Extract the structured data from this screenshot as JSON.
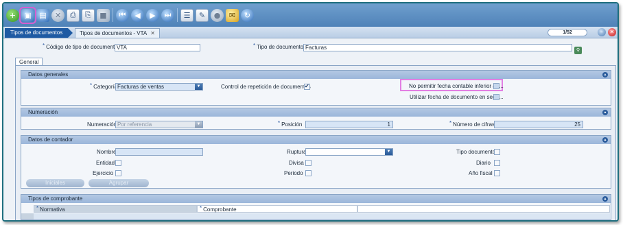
{
  "toolbar": {
    "buttons": [
      "add-icon",
      "save-icon",
      "save-close-icon",
      "delete-icon",
      "print-icon",
      "print-preview-icon",
      "disabled-icon",
      "first-icon",
      "previous-icon",
      "next-icon",
      "last-icon",
      "document-icon",
      "attach-icon",
      "disabled-icon-2",
      "email-icon",
      "refresh-icon"
    ]
  },
  "tabs": {
    "parent": "Tipos de documentos",
    "current": "Tipos de documentos - VTA",
    "close": "✕",
    "pager": "1/52"
  },
  "header": {
    "code_label": "Código de tipo de documento",
    "code_value": "VTA",
    "type_label": "Tipo de documento",
    "type_value": "Facturas"
  },
  "general_tab": "General",
  "datos_generales": {
    "title": "Datos generales",
    "categoria_label": "Categoría",
    "categoria_value": "Facturas de ventas",
    "control_label": "Control de repetición de documentos",
    "no_permitir_label": "No permitir fecha contable inferior a f...",
    "utilizar_label": "Utilizar fecha de documento en segu..."
  },
  "numeracion": {
    "title": "Numeración",
    "numeracion_label": "Numeración",
    "numeracion_value": "Por referencia",
    "posicion_label": "Posición",
    "posicion_value": "1",
    "cifras_label": "Número de cifras",
    "cifras_value": "25"
  },
  "contador": {
    "title": "Datos de contador",
    "nombre_label": "Nombre",
    "ruptura_label": "Ruptura",
    "tipo_doc_label": "Tipo documento",
    "entidad_label": "Entidad",
    "divisa_label": "Divisa",
    "diario_label": "Diario",
    "ejercicio_label": "Ejercicio",
    "periodo_label": "Periodo",
    "anio_label": "Año fiscal",
    "btn1": "Iniciales",
    "btn2": "Agrupar"
  },
  "comprobante": {
    "title": "Tipos de comprobante",
    "col1": "Normativa",
    "col2": "Comprobante"
  }
}
